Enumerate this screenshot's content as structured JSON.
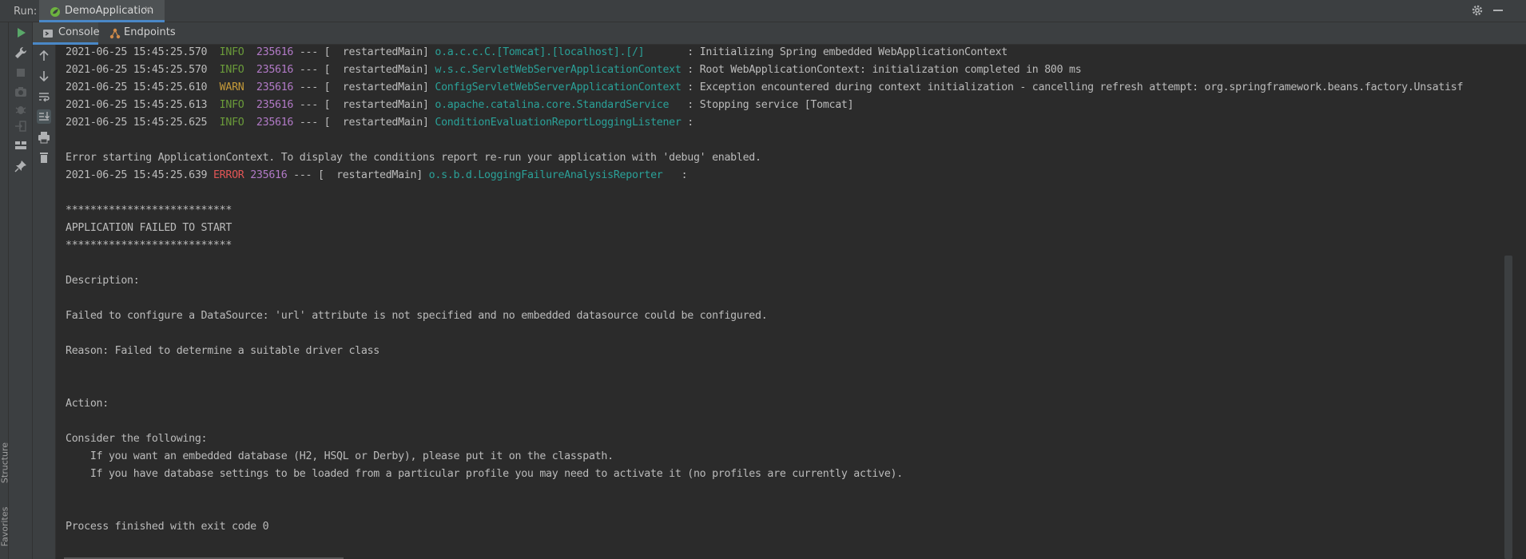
{
  "run_bar": {
    "label": "Run:",
    "tab_label": "DemoApplication",
    "close_glyph": "×",
    "icons": [
      "spring-boot-icon",
      "gear-icon",
      "minimize-icon"
    ]
  },
  "side_labels": [
    "Structure",
    "Favorites"
  ],
  "tools": [
    "rerun-icon",
    "wrench-icon",
    "stop-icon",
    "camera-icon",
    "bug-icon",
    "exit-icon",
    "layout-icon",
    "pin-icon"
  ],
  "sub_tabs": [
    {
      "label": "Console",
      "icon": "console-icon",
      "active": true
    },
    {
      "label": "Endpoints",
      "icon": "endpoints-icon",
      "active": false
    }
  ],
  "console_tools": [
    "scroll-up-icon",
    "scroll-down-icon",
    "soft-wrap-icon",
    "scroll-to-end-icon",
    "print-icon",
    "trash-icon"
  ],
  "colors": {
    "info": "#6a9a3a",
    "warn": "#c49a3a",
    "error": "#e05555",
    "pid": "#b27ac7",
    "logger": "#2aa198",
    "accent": "#4a88c7"
  },
  "console": {
    "log_lines": [
      {
        "ts": "2021-06-25 15:45:25.570",
        "level": "INFO ",
        "pid": "235616",
        "mid": " --- [  restartedMain] ",
        "logger": "o.a.c.c.C.[Tomcat].[localhost].[/]      ",
        "msg": " : Initializing Spring embedded WebApplicationContext"
      },
      {
        "ts": "2021-06-25 15:45:25.570",
        "level": "INFO ",
        "pid": "235616",
        "mid": " --- [  restartedMain] ",
        "logger": "w.s.c.ServletWebServerApplicationContext",
        "msg": " : Root WebApplicationContext: initialization completed in 800 ms"
      },
      {
        "ts": "2021-06-25 15:45:25.610",
        "level": "WARN ",
        "pid": "235616",
        "mid": " --- [  restartedMain] ",
        "logger": "ConfigServletWebServerApplicationContext",
        "msg": " : Exception encountered during context initialization - cancelling refresh attempt: org.springframework.beans.factory.Unsatisf"
      },
      {
        "ts": "2021-06-25 15:45:25.613",
        "level": "INFO ",
        "pid": "235616",
        "mid": " --- [  restartedMain] ",
        "logger": "o.apache.catalina.core.StandardService  ",
        "msg": " : Stopping service [Tomcat]"
      },
      {
        "ts": "2021-06-25 15:45:25.625",
        "level": "INFO ",
        "pid": "235616",
        "mid": " --- [  restartedMain] ",
        "logger": "ConditionEvaluationReportLoggingListener",
        "msg": " :"
      }
    ],
    "error_hint": "Error starting ApplicationContext. To display the conditions report re-run your application with 'debug' enabled.",
    "error_line": {
      "ts": "2021-06-25 15:45:25.639",
      "level": "ERROR",
      "pid": "235616",
      "mid": " --- [  restartedMain] ",
      "logger": "o.s.b.d.LoggingFailureAnalysisReporter  ",
      "msg": " :"
    },
    "stars": "***************************",
    "failed_title": "APPLICATION FAILED TO START",
    "description_label": "Description:",
    "description_text": "Failed to configure a DataSource: 'url' attribute is not specified and no embedded datasource could be configured.",
    "reason_text": "Reason: Failed to determine a suitable driver class",
    "action_label": "Action:",
    "consider_text": "Consider the following:",
    "consider_items": [
      "    If you want an embedded database (H2, HSQL or Derby), please put it on the classpath.",
      "    If you have database settings to be loaded from a particular profile you may need to activate it (no profiles are currently active)."
    ],
    "process_text": "Process finished with exit code 0"
  }
}
